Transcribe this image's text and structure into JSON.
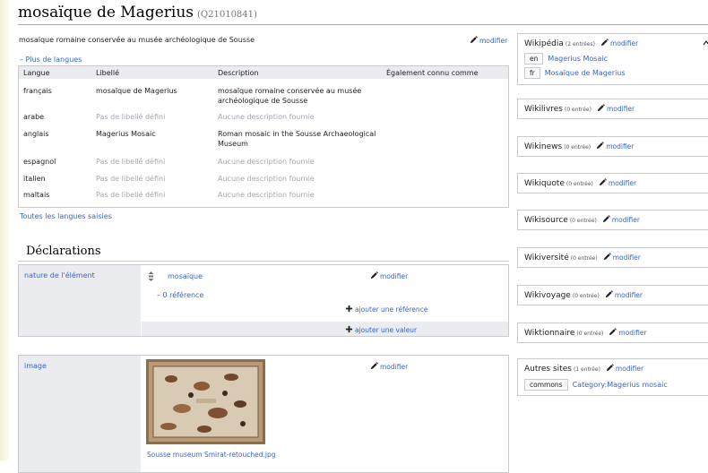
{
  "page": {
    "title": "mosaïque de Magerius",
    "qid": "(Q21010841)",
    "description": "mosaïque romaine conservée au musée archéologique de Sousse",
    "edit_label": "modifier",
    "more_languages": "– Plus de langues",
    "all_languages": "Toutes les langues saisies"
  },
  "lang_table": {
    "headers": [
      "Langue",
      "Libellé",
      "Description",
      "Également connu comme"
    ],
    "rows": [
      {
        "lang": "français",
        "label": "mosaïque de Magerius",
        "desc1": "mosaïque romaine conservée au musée",
        "desc2": "archéologique de Sousse"
      },
      {
        "lang": "arabe",
        "label": "Pas de libellé défini",
        "desc1": "Aucune description fournie",
        "desc2": ""
      },
      {
        "lang": "anglais",
        "label": "Magerius Mosaic",
        "desc1": "Roman mosaic in the Sousse Archaeological",
        "desc2": "Museum"
      },
      {
        "lang": "espagnol",
        "label": "Pas de libellé défini",
        "desc1": "Aucune description fournie",
        "desc2": ""
      },
      {
        "lang": "italien",
        "label": "Pas de libellé défini",
        "desc1": "Aucune description fournie",
        "desc2": ""
      },
      {
        "lang": "maltais",
        "label": "Pas de libellé défini",
        "desc1": "Aucune description fournie",
        "desc2": ""
      }
    ]
  },
  "declarations": {
    "heading": "Déclarations",
    "statements": [
      {
        "property": "nature de l'élément",
        "value": "mosaïque",
        "references": "– 0 référence",
        "add_reference": "ajouter une référence",
        "add_value": "ajouter une valeur"
      },
      {
        "property": "image",
        "file": "Sousse museum Smirat-retouched.jpg"
      }
    ]
  },
  "sidebar": {
    "boxes": [
      {
        "name": "Wikipédia",
        "count": "(2 entrées)",
        "links": [
          {
            "code": "en",
            "title": "Magerius Mosaic"
          },
          {
            "code": "fr",
            "title": "Mosaïque de Magerius"
          }
        ]
      },
      {
        "name": "Wikilivres",
        "count": "(0 entrée)"
      },
      {
        "name": "Wikinews",
        "count": "(0 entrée)"
      },
      {
        "name": "Wikiquote",
        "count": "(0 entrée)"
      },
      {
        "name": "Wikisource",
        "count": "(0 entrée)"
      },
      {
        "name": "Wikiversité",
        "count": "(0 entrée)"
      },
      {
        "name": "Wikivoyage",
        "count": "(0 entrée)"
      },
      {
        "name": "Wiktionnaire",
        "count": "(0 entrée)"
      },
      {
        "name": "Autres sites",
        "count": "(1 entrée)",
        "links": [
          {
            "code": "commons",
            "title": "Category:Magerius mosaic"
          }
        ]
      }
    ]
  },
  "colors": {
    "link": "#3366cc",
    "muted": "#a2a9b1",
    "header_bg": "#eaecf0",
    "border": "#c8ccd1"
  }
}
